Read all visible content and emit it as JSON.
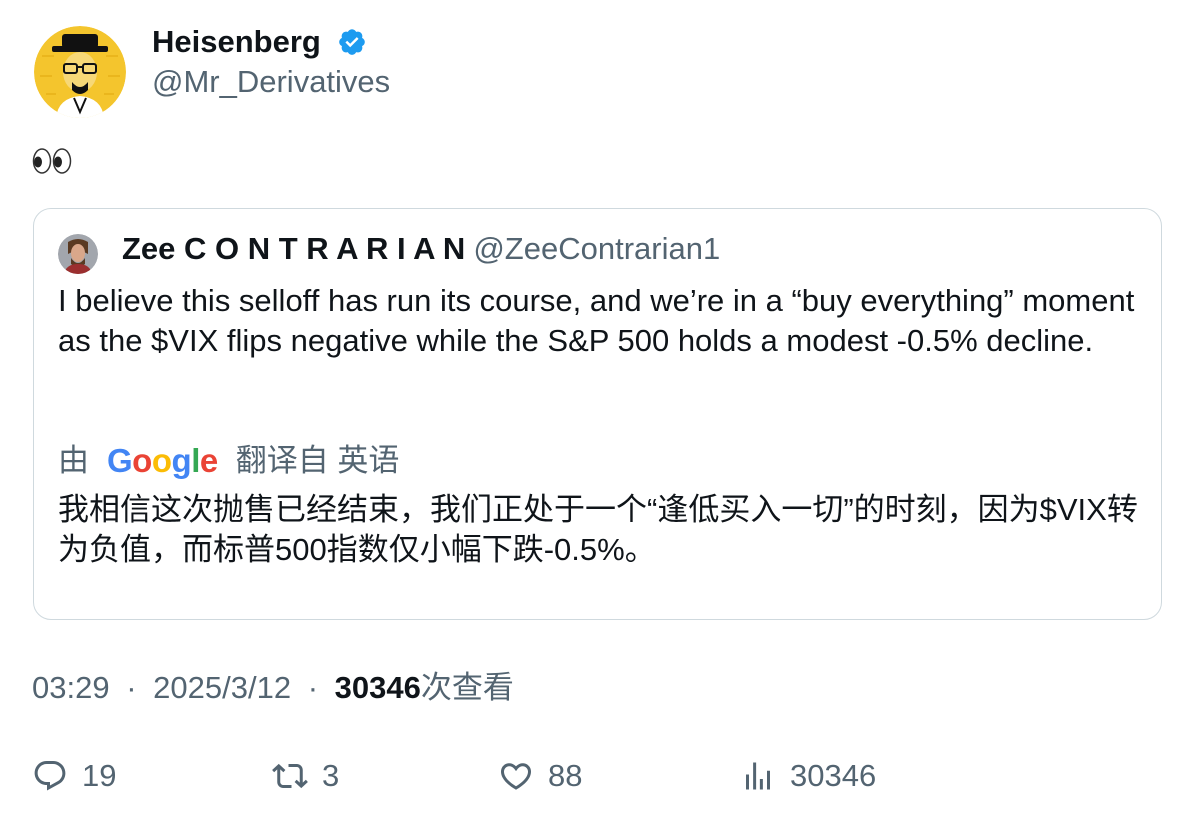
{
  "author": {
    "name": "Heisenberg",
    "handle": "@Mr_Derivatives",
    "verified_icon": "verified-badge-icon",
    "avatar": "heisenberg-avatar"
  },
  "tweet": {
    "text_emoji": "eyes-emoji"
  },
  "quoted": {
    "name": "Zee C O N T R A R I A N",
    "handle": "@ZeeContrarian1",
    "text": "I believe this selloff has run its course, and we’re in a “buy everything” moment as the $VIX flips negative while the S&P 500 holds a modest -0.5% decline.",
    "translation": {
      "by": "由",
      "provider_parts": [
        "G",
        "o",
        "o",
        "g",
        "l",
        "e"
      ],
      "from": "翻译自 英语",
      "text": "我相信这次抛售已经结束，我们正处于一个“逢低买入一切”的时刻，因为$VIX转为负值，而标普500指数仅小幅下跌-0.5%。"
    }
  },
  "meta": {
    "time": "03:29",
    "sep1": "·",
    "date": "2025/3/12",
    "sep2": "·",
    "views_count": "30346",
    "views_label": "次查看"
  },
  "actions": {
    "replies": "19",
    "retweets": "3",
    "likes": "88",
    "views": "30346"
  },
  "colors": {
    "text_primary": "#0f1419",
    "text_secondary": "#536471",
    "border": "#cfd9de",
    "verified": "#1d9bf0",
    "avatar_bg": "#f4c52d"
  }
}
